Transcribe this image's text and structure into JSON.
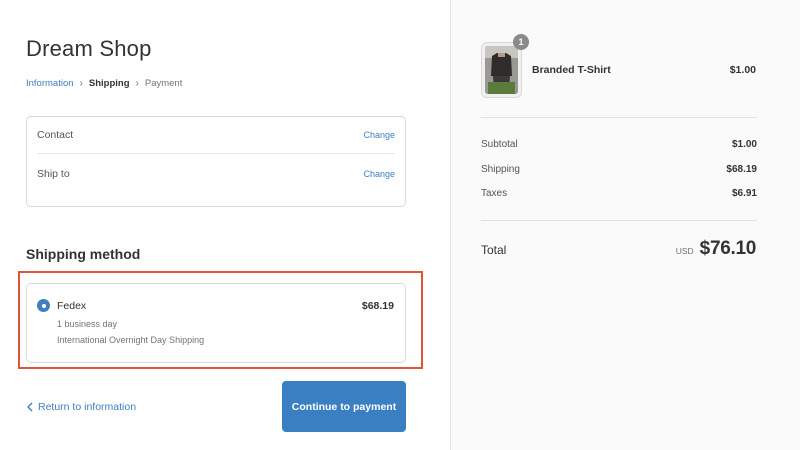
{
  "shop": {
    "name": "Dream Shop"
  },
  "breadcrumb": {
    "items": [
      {
        "label": "Information",
        "state": "link"
      },
      {
        "label": "Shipping",
        "state": "current"
      },
      {
        "label": "Payment",
        "state": "upcoming"
      }
    ],
    "separator_icon": "chevron-right-icon"
  },
  "review": {
    "rows": [
      {
        "label": "Contact",
        "action": "Change"
      },
      {
        "label": "Ship to",
        "action": "Change"
      }
    ]
  },
  "shipping_method": {
    "title": "Shipping method",
    "option": {
      "name": "Fedex",
      "price": "$68.19",
      "line1": "1 business day",
      "line2": "International Overnight Day Shipping",
      "selected": true
    },
    "highlight_color": "#e0553a"
  },
  "actions": {
    "return_label": "Return to information",
    "continue_label": "Continue to payment"
  },
  "order_summary": {
    "product": {
      "name": "Branded T-Shirt",
      "price": "$1.00",
      "quantity": "1"
    },
    "rows": [
      {
        "label": "Subtotal",
        "value": "$1.00"
      },
      {
        "label": "Shipping",
        "value": "$68.19"
      },
      {
        "label": "Taxes",
        "value": "$6.91"
      }
    ],
    "total": {
      "label": "Total",
      "currency": "USD",
      "value": "$76.10"
    }
  },
  "colors": {
    "accent": "#3a7fc1",
    "link": "#3f7fbf",
    "summary_bg": "#fafafa"
  }
}
